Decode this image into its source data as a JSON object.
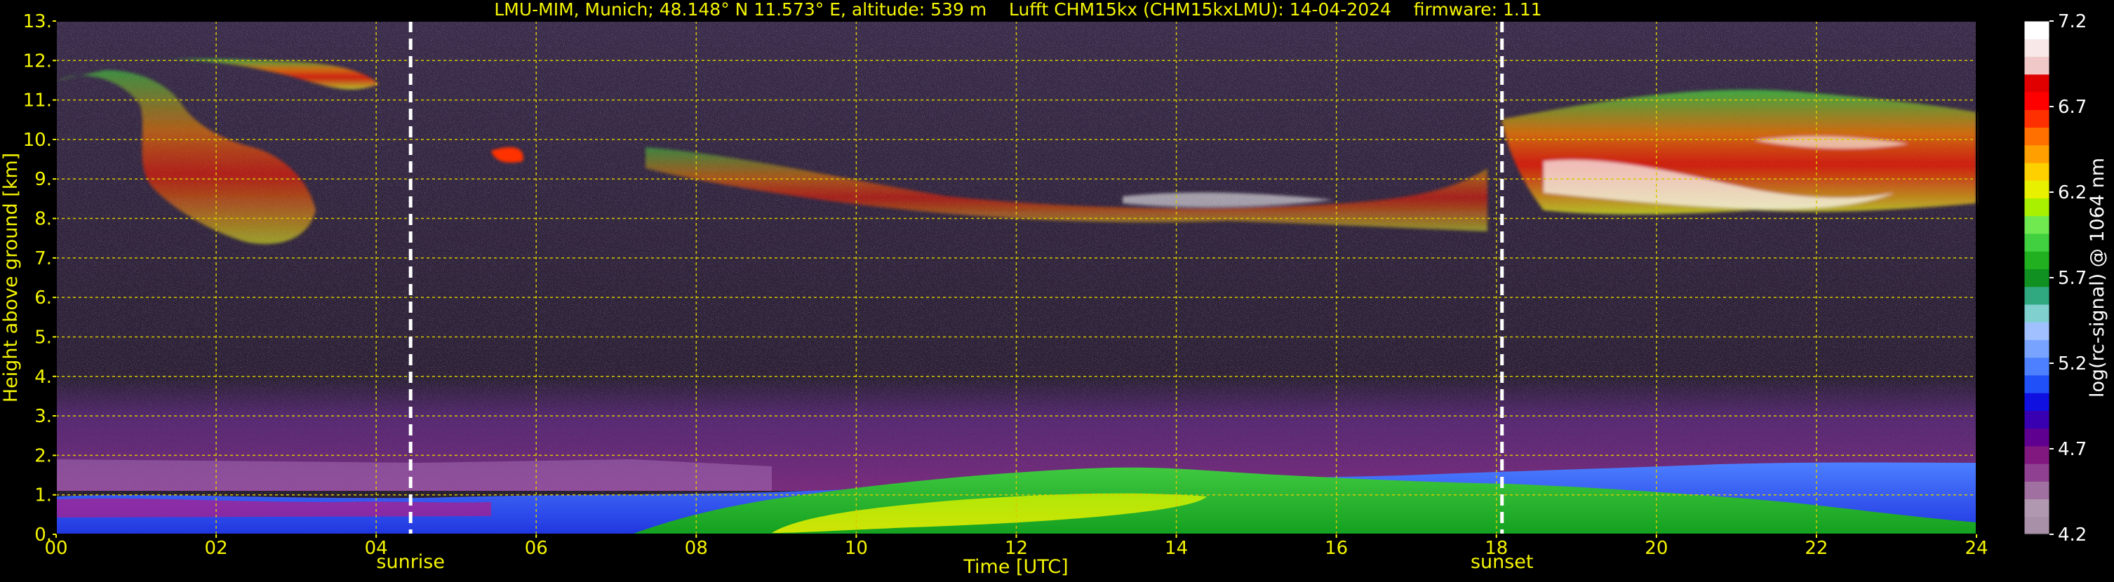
{
  "chart_data": {
    "type": "heatmap",
    "title": "LMU-MIM, Munich; 48.148° N 11.573° E, altitude: 539 m    Lufft CHM15kx (CHM15kxLMU): 14-04-2024    firmware: 1.11",
    "xlabel": "Time [UTC]",
    "ylabel": "Height above ground [km]",
    "xlim": [
      0,
      24
    ],
    "ylim": [
      0,
      13
    ],
    "x_ticks": [
      "00",
      "02",
      "04",
      "06",
      "08",
      "10",
      "12",
      "14",
      "16",
      "18",
      "20",
      "22",
      "24"
    ],
    "y_ticks": [
      "0.",
      "1.",
      "2.",
      "3.",
      "4.",
      "5.",
      "6.",
      "7.",
      "8.",
      "9.",
      "10.",
      "11.",
      "12.",
      "13."
    ],
    "grid": true,
    "colorbar": {
      "label": "log(rc-signal) @ 1064 nm",
      "range": [
        4.2,
        7.2
      ],
      "ticks": [
        "4.2",
        "4.7",
        "5.2",
        "5.7",
        "6.2",
        "6.7",
        "7.2"
      ],
      "colors": [
        "#a890a8",
        "#b098b0",
        "#a070a0",
        "#904090",
        "#801880",
        "#600090",
        "#3800b0",
        "#1010e0",
        "#2050f8",
        "#4c80ff",
        "#78a4ff",
        "#a0c0ff",
        "#80d0d0",
        "#30a880",
        "#109020",
        "#20b020",
        "#40d040",
        "#70e850",
        "#a8f000",
        "#e8f000",
        "#ffd000",
        "#ffa000",
        "#ff7000",
        "#ff3000",
        "#ff0000",
        "#e00000",
        "#f0c8c8",
        "#f8e8e8",
        "#ffffff"
      ]
    },
    "annotations": [
      {
        "label": "sunrise",
        "x": 4.43
      },
      {
        "label": "sunset",
        "x": 18.07
      }
    ]
  }
}
